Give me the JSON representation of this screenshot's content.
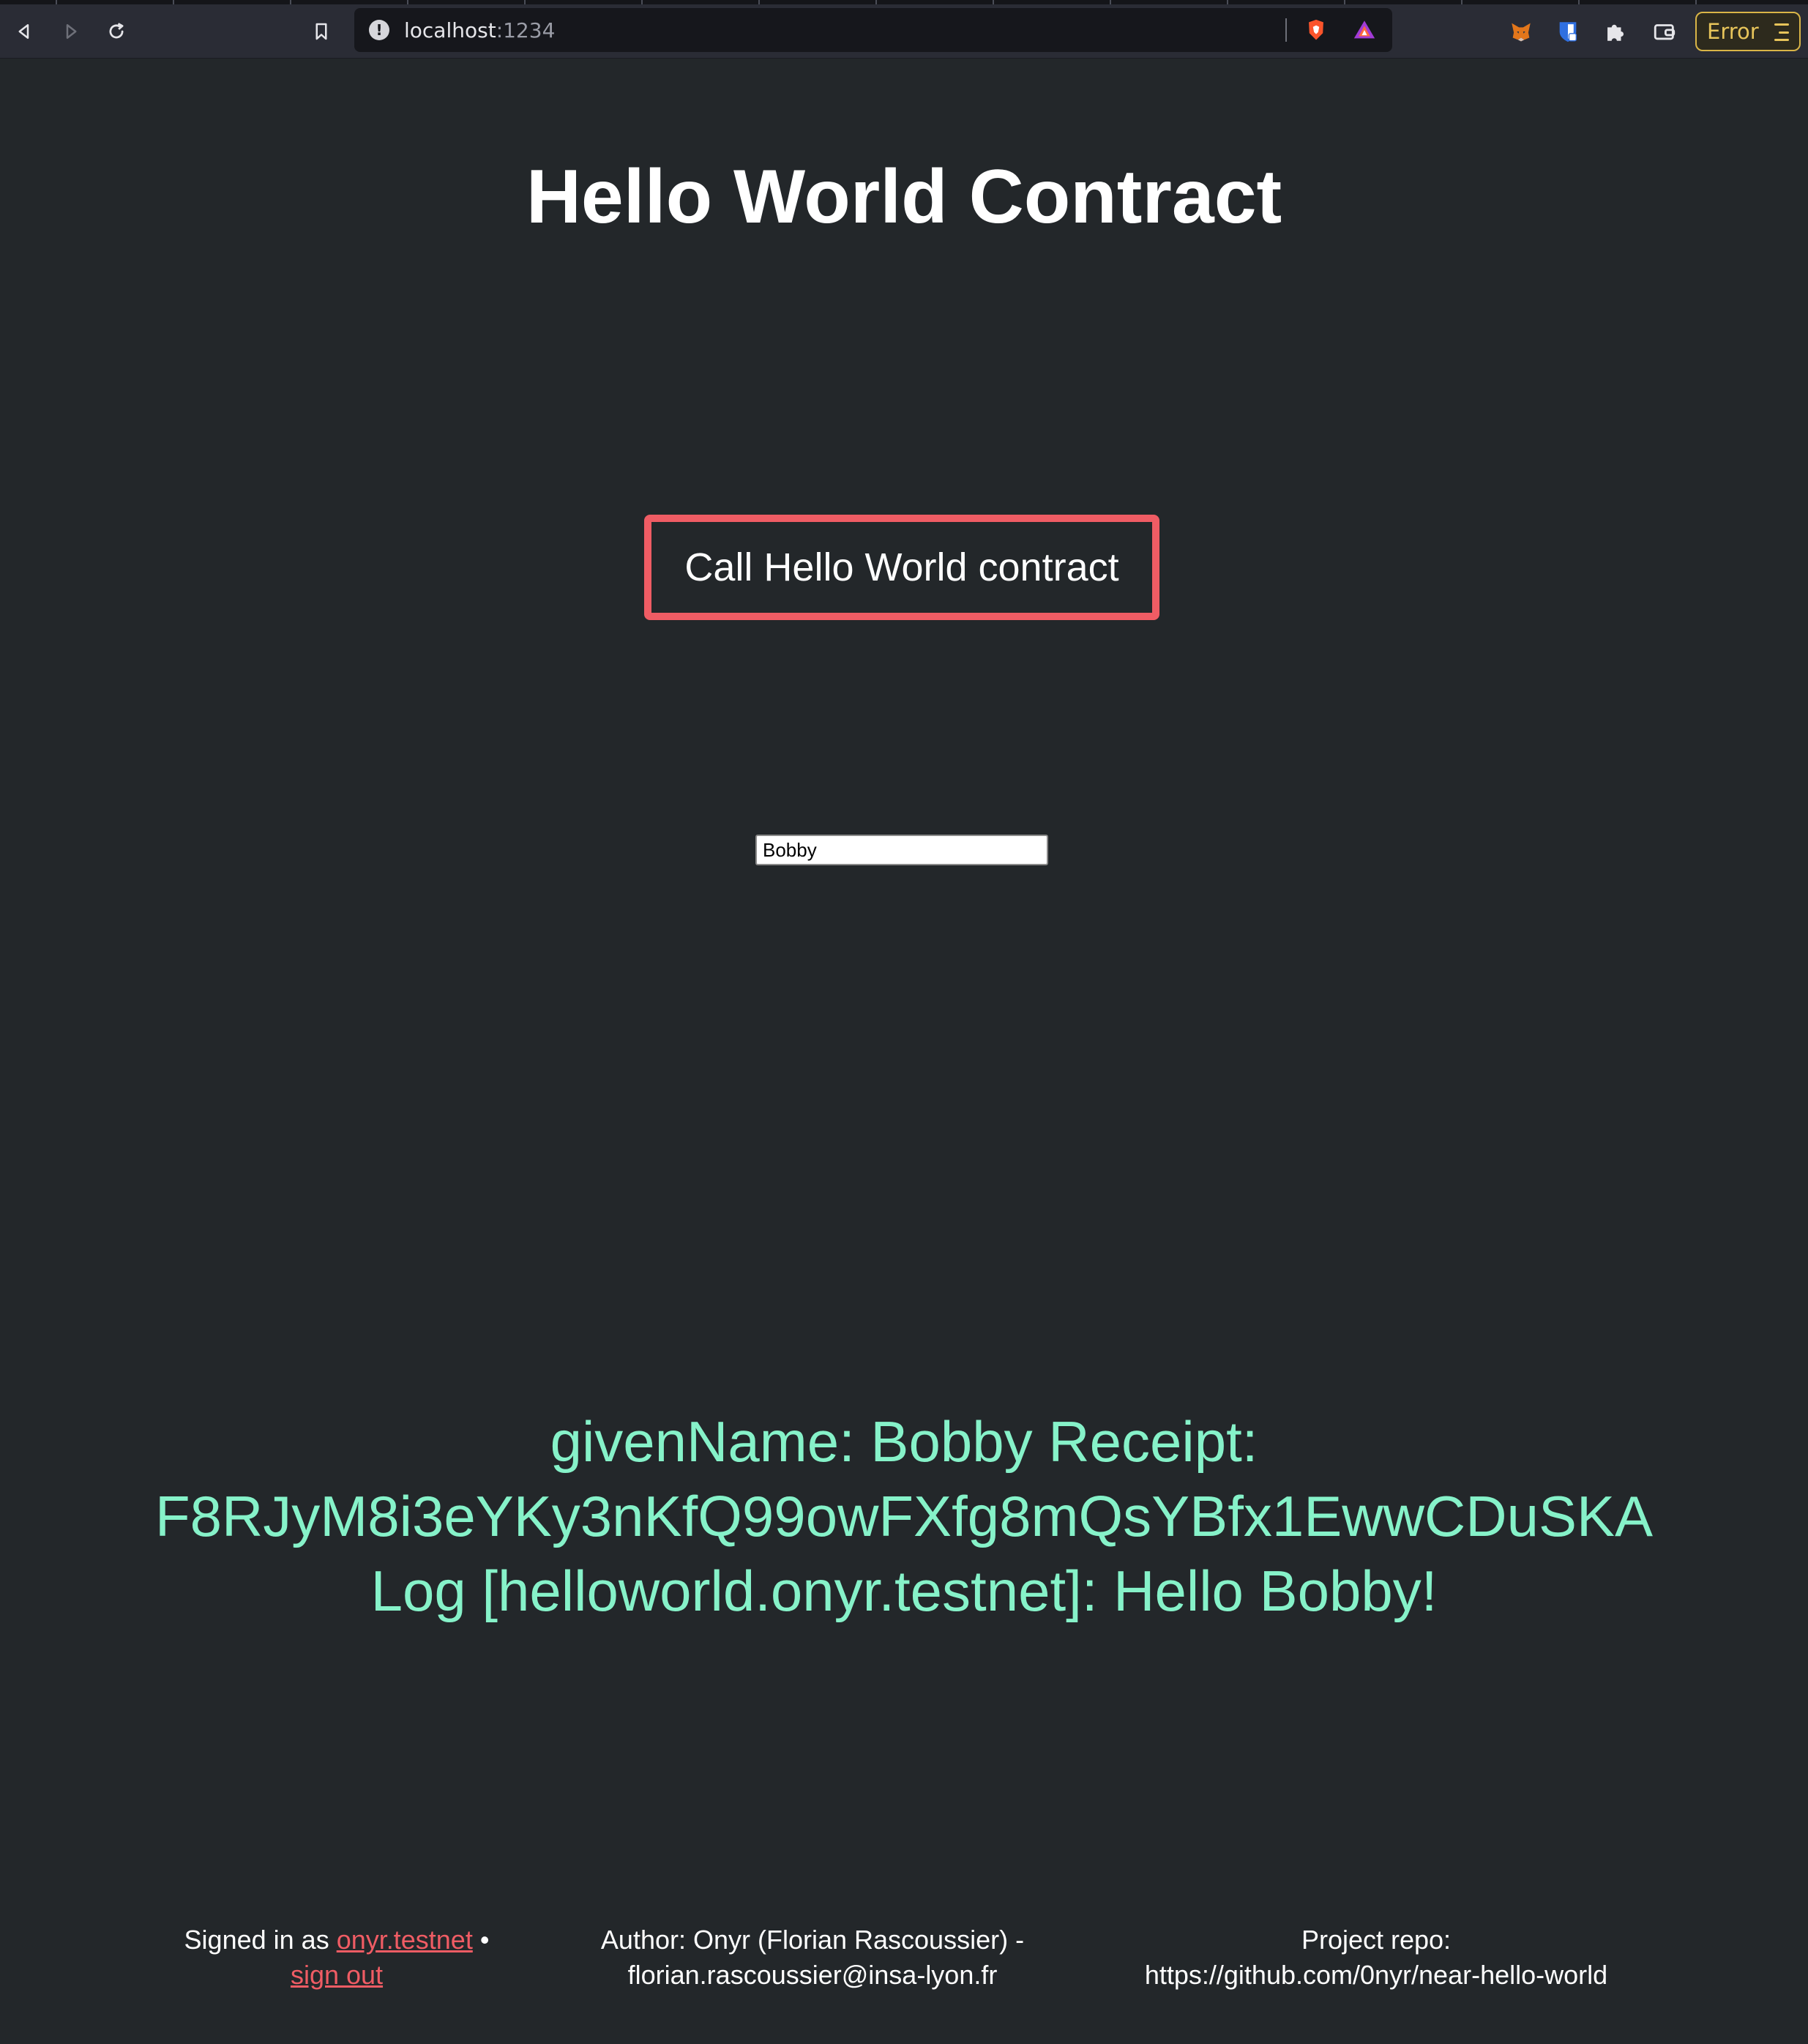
{
  "browser": {
    "url_host": "localhost",
    "url_port": ":1234",
    "url_info": "!",
    "error_label": "Error"
  },
  "page": {
    "title": "Hello World Contract",
    "call_button_label": "Call Hello World contract",
    "name_input_value": "Bobby",
    "result_lines": [
      "givenName: Bobby Receipt:",
      "F8RJyM8i3eYKy3nKfQ99owFXfg8mQsYBfx1EwwCDuSKA",
      "Log [helloworld.onyr.testnet]: Hello Bobby!"
    ]
  },
  "footer": {
    "signed_in_prefix": "Signed in as",
    "account": "onyr.testnet",
    "bullet": "•",
    "sign_out": "sign out",
    "author_line1": "Author: Onyr (Florian Rascoussier) -",
    "author_line2": "florian.rascoussier@insa-lyon.fr",
    "repo_line1": "Project repo:",
    "repo_line2": "https://github.com/0nyr/near-hello-world"
  },
  "colors": {
    "background": "#23272a",
    "accent": "#ef5c64",
    "result_text": "#86f2c9",
    "error": "#e7c45a"
  }
}
